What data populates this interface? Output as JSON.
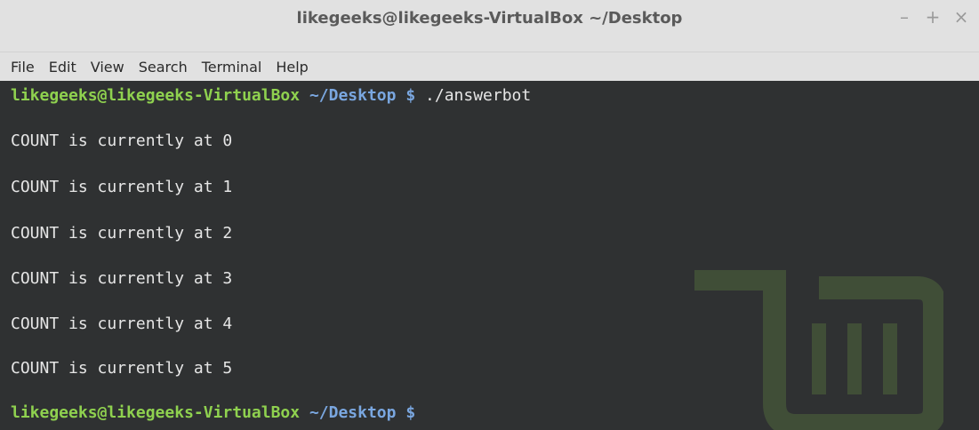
{
  "window": {
    "title": "likegeeks@likegeeks-VirtualBox ~/Desktop",
    "buttons": {
      "minimize": "–",
      "maximize": "+",
      "close": "×"
    }
  },
  "menu": [
    "File",
    "Edit",
    "View",
    "Search",
    "Terminal",
    "Help"
  ],
  "terminal": {
    "prompt_user": "likegeeks@likegeeks-VirtualBox",
    "prompt_path": "~/Desktop $",
    "command": "./answerbot",
    "output": [
      "COUNT is currently at 0",
      "COUNT is currently at 1",
      "COUNT is currently at 2",
      "COUNT is currently at 3",
      "COUNT is currently at 4",
      "COUNT is currently at 5"
    ]
  },
  "colors": {
    "prompt_user": "#8fd14f",
    "prompt_path": "#7aa7e0",
    "terminal_bg": "#2f3132",
    "chrome_bg": "#e1e1e1"
  },
  "icons": {
    "watermark": "linux-mint-logo-icon"
  }
}
